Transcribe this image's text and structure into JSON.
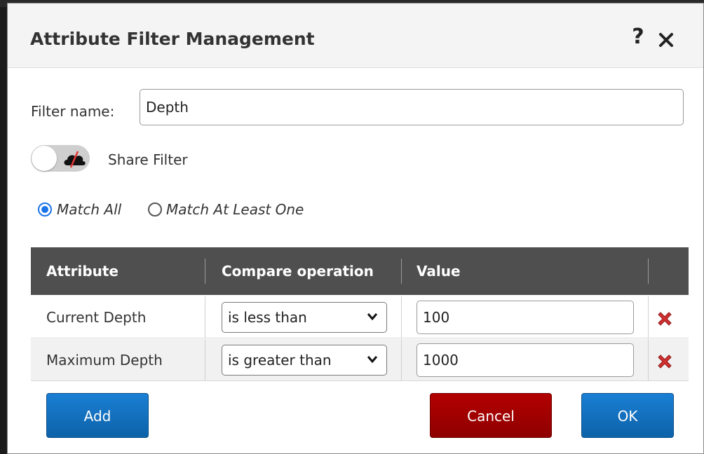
{
  "dialog": {
    "title": "Attribute Filter Management",
    "help_icon": "help-icon",
    "close_icon": "close-icon"
  },
  "filter": {
    "name_label": "Filter name:",
    "name_value": "Depth"
  },
  "share": {
    "label": "Share Filter",
    "enabled": false,
    "icon": "cloud-off-icon"
  },
  "match": {
    "options": [
      "Match All",
      "Match At Least One"
    ],
    "selected": "Match All"
  },
  "table": {
    "columns": [
      "Attribute",
      "Compare operation",
      "Value",
      ""
    ],
    "rows": [
      {
        "attribute": "Current Depth",
        "operation": "is less than",
        "value": "100"
      },
      {
        "attribute": "Maximum Depth",
        "operation": "is greater than",
        "value": "1000"
      }
    ],
    "delete_icon": "delete-icon"
  },
  "buttons": {
    "add": "Add",
    "cancel": "Cancel",
    "ok": "OK"
  },
  "colors": {
    "primary_button": "#1170c4",
    "cancel_button": "#a00000",
    "table_header": "#4f4f4f",
    "radio_selected": "#1a73e8",
    "delete_icon": "#d32f2f"
  }
}
